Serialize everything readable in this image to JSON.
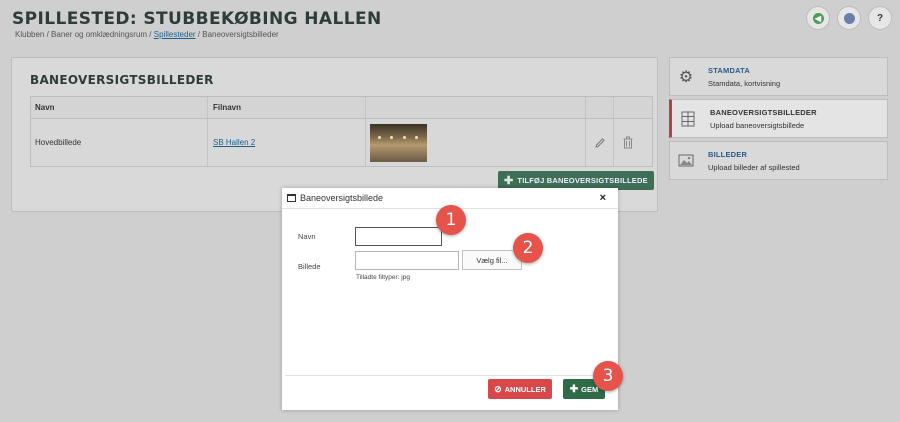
{
  "header": {
    "title": "SPILLESTED: STUBBEKØBING HALLEN",
    "breadcrumb": {
      "part1": "Klubben / Baner og omklædningsrum / ",
      "link": "Spillesteder",
      "part2": " / Baneoversigtsbilleder"
    }
  },
  "top_icons": {
    "help_label": "?"
  },
  "main": {
    "title": "BANEOVERSIGTSBILLEDER",
    "table": {
      "headers": [
        "Navn",
        "Filnavn"
      ],
      "rows": [
        {
          "name": "Hovedbillede",
          "file": "SB Hallen 2"
        }
      ]
    },
    "add_button": "TILFØJ BANEOVERSIGTSBILLEDE"
  },
  "sidebar": {
    "items": [
      {
        "title": "STAMDATA",
        "subtitle": "Stamdata, kortvisning",
        "icon": "gear-icon"
      },
      {
        "title": "BANEOVERSIGTSBILLEDER",
        "subtitle": "Upload baneoversigtsbillede",
        "icon": "court-icon"
      },
      {
        "title": "BILLEDER",
        "subtitle": "Upload billeder af spillested",
        "icon": "image-icon"
      }
    ]
  },
  "modal": {
    "title": "Baneoversigtsbillede",
    "close": "×",
    "name_label": "Navn",
    "name_value": "",
    "image_label": "Billede",
    "file_button": "Vælg fil...",
    "hint": "Tilladte filtyper: jpg",
    "cancel_label": "ANNULLER",
    "save_label": "GEM"
  },
  "callouts": [
    "1",
    "2",
    "3"
  ],
  "colors": {
    "callout": "#e5534b",
    "save": "#2f6b47",
    "cancel": "#d84848",
    "active_marker": "#b24343"
  }
}
